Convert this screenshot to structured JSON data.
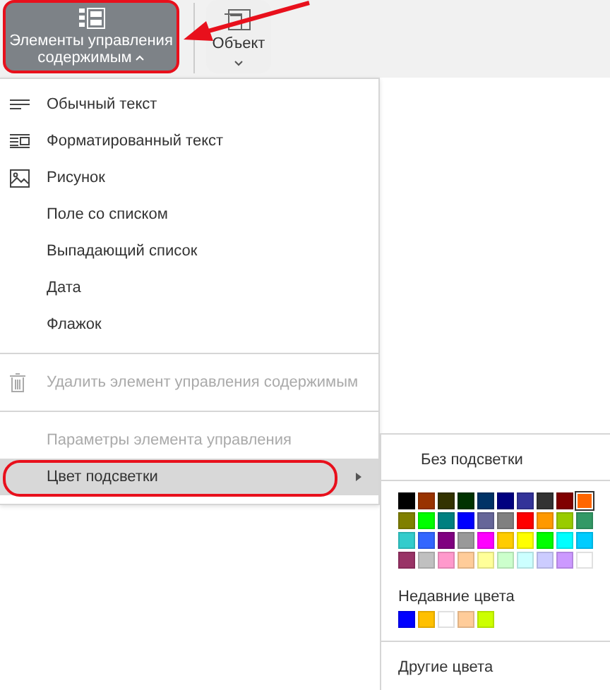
{
  "toolbar": {
    "buttons": [
      {
        "kind": "controls",
        "label": "Элементы управления содержимым",
        "selected": true,
        "annotated": true
      },
      {
        "kind": "object",
        "label": "Объект",
        "selected": false,
        "annotated": false
      }
    ],
    "annotation_arrow": true
  },
  "menu": {
    "sections": [
      {
        "items": [
          {
            "kind": "text",
            "label": "Обычный текст",
            "disabled": false,
            "expanded": false,
            "has_submenu": false,
            "annotated": false
          },
          {
            "kind": "richtext",
            "label": "Форматированный текст",
            "disabled": false,
            "expanded": false,
            "has_submenu": false,
            "annotated": false
          },
          {
            "kind": "image",
            "label": "Рисунок",
            "disabled": false,
            "expanded": false,
            "has_submenu": false,
            "annotated": false
          },
          {
            "kind": "plain",
            "label": "Поле со списком",
            "disabled": false,
            "expanded": false,
            "has_submenu": false,
            "annotated": false
          },
          {
            "kind": "plain",
            "label": "Выпадающий список",
            "disabled": false,
            "expanded": false,
            "has_submenu": false,
            "annotated": false
          },
          {
            "kind": "plain",
            "label": "Дата",
            "disabled": false,
            "expanded": false,
            "has_submenu": false,
            "annotated": false
          },
          {
            "kind": "plain",
            "label": "Флажок",
            "disabled": false,
            "expanded": false,
            "has_submenu": false,
            "annotated": false
          }
        ]
      },
      {
        "items": [
          {
            "kind": "delete",
            "label": "Удалить элемент управления содержимым",
            "disabled": true,
            "expanded": false,
            "has_submenu": false,
            "annotated": false
          }
        ]
      },
      {
        "items": [
          {
            "kind": "plain",
            "label": "Параметры элемента управления",
            "disabled": true,
            "expanded": false,
            "has_submenu": false,
            "annotated": false
          },
          {
            "kind": "plain",
            "label": "Цвет подсветки",
            "disabled": false,
            "expanded": true,
            "has_submenu": true,
            "annotated": true
          }
        ]
      }
    ]
  },
  "submenu": {
    "none_label": "Без подсветки",
    "palette": [
      {
        "color": "#000000",
        "selected": false
      },
      {
        "color": "#993300",
        "selected": false
      },
      {
        "color": "#333300",
        "selected": false
      },
      {
        "color": "#003300",
        "selected": false
      },
      {
        "color": "#003366",
        "selected": false
      },
      {
        "color": "#000080",
        "selected": false
      },
      {
        "color": "#333399",
        "selected": false
      },
      {
        "color": "#333333",
        "selected": false
      },
      {
        "color": "#800000",
        "selected": false
      },
      {
        "color": "#ff6600",
        "selected": true
      },
      {
        "color": "#808000",
        "selected": false
      },
      {
        "color": "#00ff00",
        "selected": false
      },
      {
        "color": "#008080",
        "selected": false
      },
      {
        "color": "#0000ff",
        "selected": false
      },
      {
        "color": "#666699",
        "selected": false
      },
      {
        "color": "#808080",
        "selected": false
      },
      {
        "color": "#ff0000",
        "selected": false
      },
      {
        "color": "#ff9900",
        "selected": false
      },
      {
        "color": "#99cc00",
        "selected": false
      },
      {
        "color": "#339966",
        "selected": false
      },
      {
        "color": "#33cccc",
        "selected": false
      },
      {
        "color": "#3366ff",
        "selected": false
      },
      {
        "color": "#800080",
        "selected": false
      },
      {
        "color": "#999999",
        "selected": false
      },
      {
        "color": "#ff00ff",
        "selected": false
      },
      {
        "color": "#ffcc00",
        "selected": false
      },
      {
        "color": "#ffff00",
        "selected": false
      },
      {
        "color": "#00ff00",
        "selected": false
      },
      {
        "color": "#00ffff",
        "selected": false
      },
      {
        "color": "#00ccff",
        "selected": false
      },
      {
        "color": "#993366",
        "selected": false
      },
      {
        "color": "#c0c0c0",
        "selected": false
      },
      {
        "color": "#ff99cc",
        "selected": false
      },
      {
        "color": "#ffcc99",
        "selected": false
      },
      {
        "color": "#ffff99",
        "selected": false
      },
      {
        "color": "#ccffcc",
        "selected": false
      },
      {
        "color": "#ccffff",
        "selected": false
      },
      {
        "color": "#ccccff",
        "selected": false
      },
      {
        "color": "#cc99ff",
        "selected": false
      },
      {
        "color": "#ffffff",
        "selected": false
      }
    ],
    "recent_title": "Недавние цвета",
    "recent": [
      {
        "color": "#0000ff"
      },
      {
        "color": "#ffc000"
      },
      {
        "color": "#ffffff"
      },
      {
        "color": "#ffcc99"
      },
      {
        "color": "#ccff00"
      }
    ],
    "more_label": "Другие цвета"
  }
}
